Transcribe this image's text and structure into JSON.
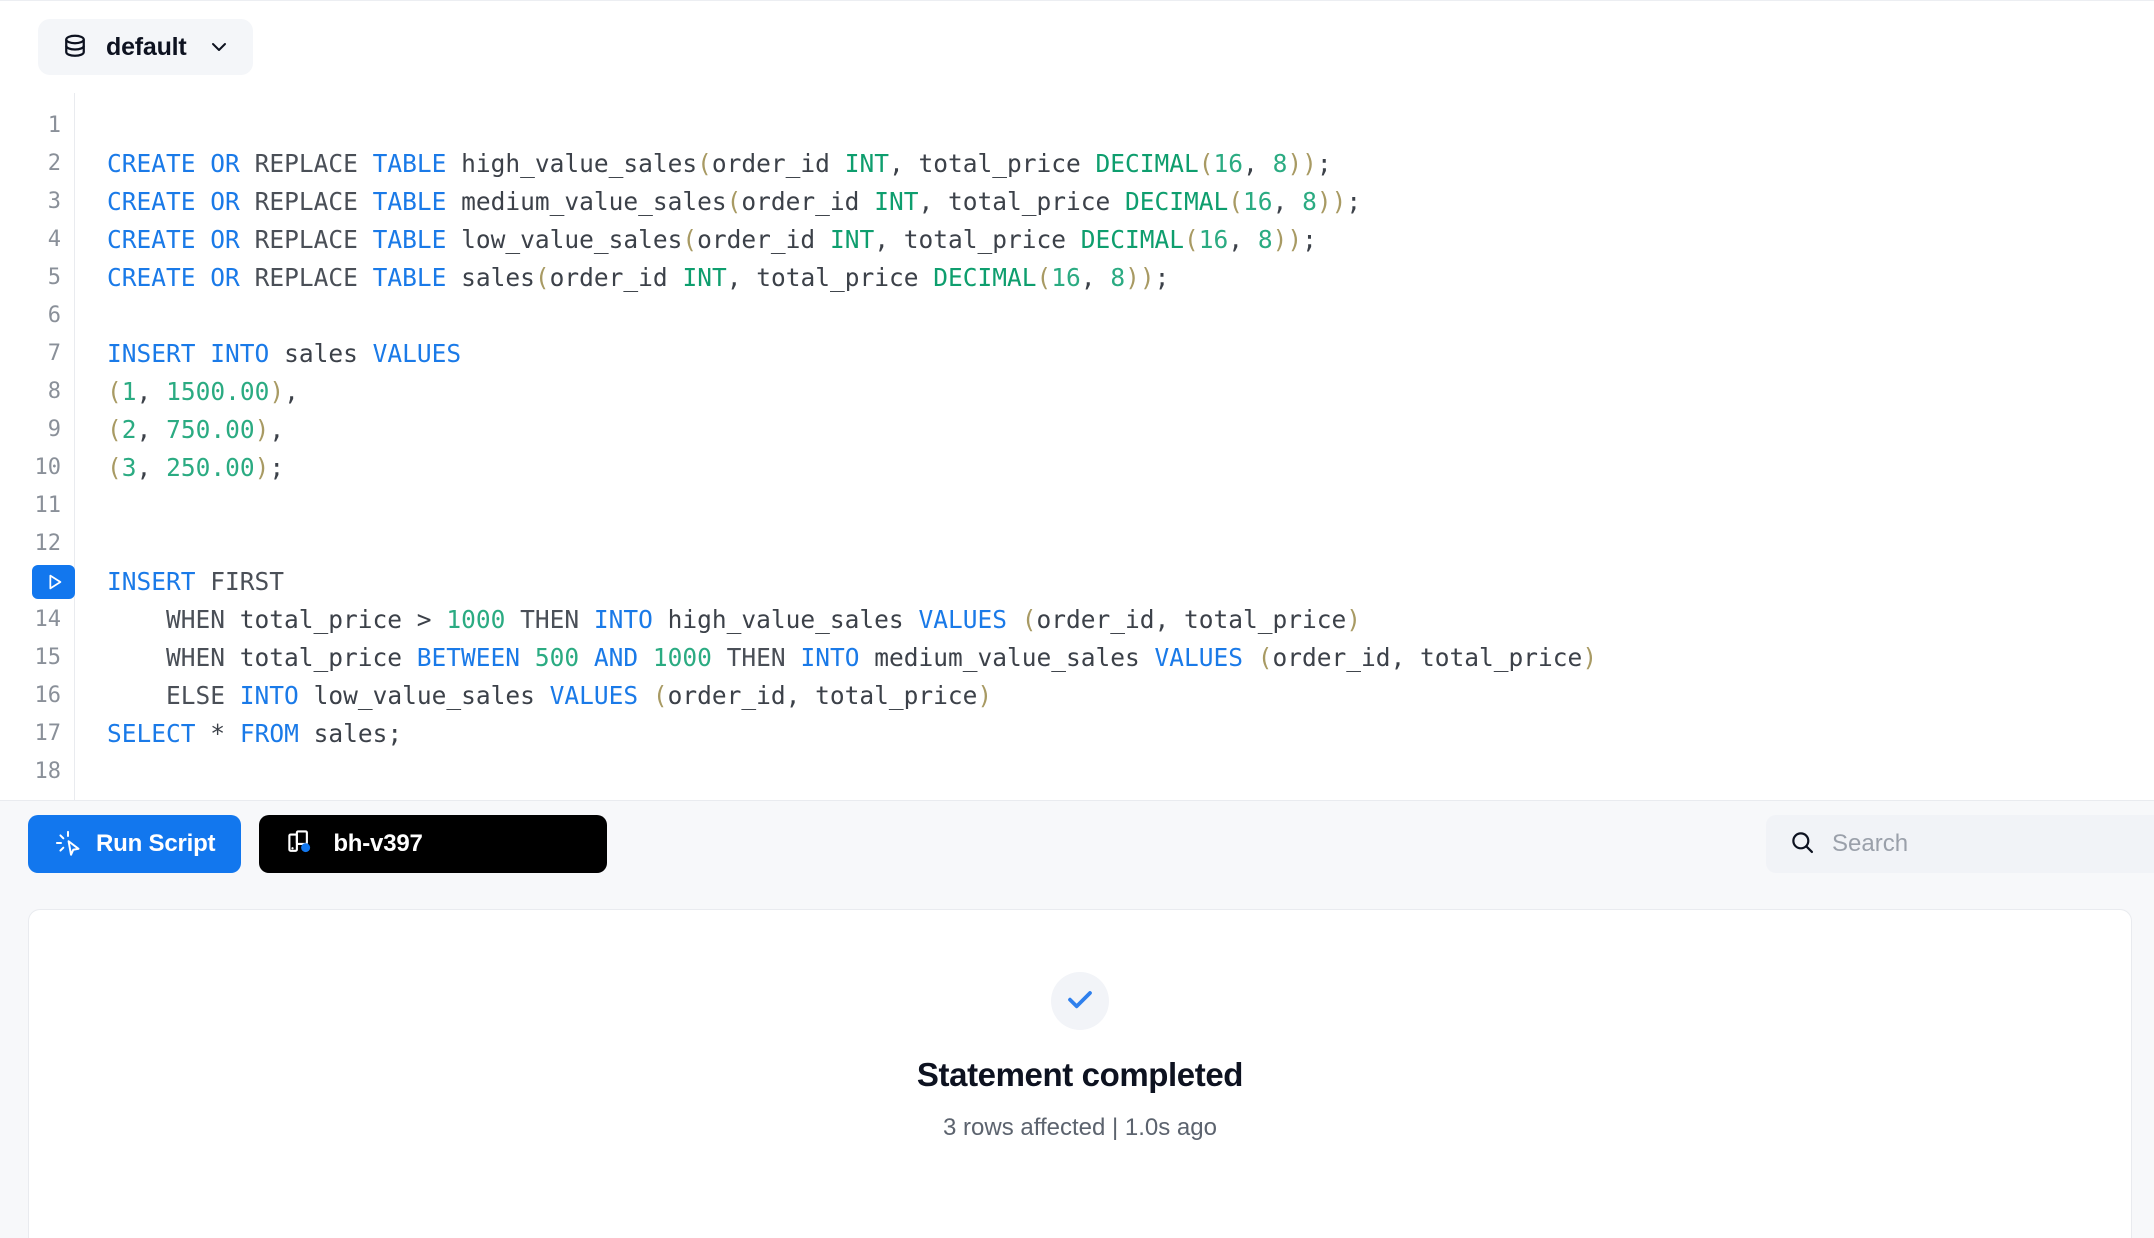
{
  "context_bar": {
    "database_label": "default",
    "database_icon": "database-icon",
    "chevron_icon": "chevron-down-icon"
  },
  "editor": {
    "line_numbers": [
      "1",
      "2",
      "3",
      "4",
      "5",
      "6",
      "7",
      "8",
      "9",
      "10",
      "11",
      "12",
      "13",
      "14",
      "15",
      "16",
      "17",
      "18"
    ],
    "run_line": 13,
    "run_icon": "play-icon",
    "lines": [
      [],
      [
        {
          "t": "CREATE",
          "c": "k"
        },
        {
          "t": " ",
          "c": "op"
        },
        {
          "t": "OR",
          "c": "k"
        },
        {
          "t": " ",
          "c": "op"
        },
        {
          "t": "REPLACE",
          "c": "kd"
        },
        {
          "t": " ",
          "c": "op"
        },
        {
          "t": "TABLE",
          "c": "k"
        },
        {
          "t": " ",
          "c": "op"
        },
        {
          "t": "high_value_sales",
          "c": "id"
        },
        {
          "t": "(",
          "c": "p"
        },
        {
          "t": "order_id",
          "c": "id"
        },
        {
          "t": " ",
          "c": "op"
        },
        {
          "t": "INT",
          "c": "t"
        },
        {
          "t": ",",
          "c": "op"
        },
        {
          "t": " total_price ",
          "c": "id"
        },
        {
          "t": "DECIMAL",
          "c": "t"
        },
        {
          "t": "(",
          "c": "p"
        },
        {
          "t": "16",
          "c": "n"
        },
        {
          "t": ",",
          "c": "op"
        },
        {
          "t": " ",
          "c": "op"
        },
        {
          "t": "8",
          "c": "n"
        },
        {
          "t": "))",
          "c": "p"
        },
        {
          "t": ";",
          "c": "op"
        }
      ],
      [
        {
          "t": "CREATE",
          "c": "k"
        },
        {
          "t": " ",
          "c": "op"
        },
        {
          "t": "OR",
          "c": "k"
        },
        {
          "t": " ",
          "c": "op"
        },
        {
          "t": "REPLACE",
          "c": "kd"
        },
        {
          "t": " ",
          "c": "op"
        },
        {
          "t": "TABLE",
          "c": "k"
        },
        {
          "t": " ",
          "c": "op"
        },
        {
          "t": "medium_value_sales",
          "c": "id"
        },
        {
          "t": "(",
          "c": "p"
        },
        {
          "t": "order_id",
          "c": "id"
        },
        {
          "t": " ",
          "c": "op"
        },
        {
          "t": "INT",
          "c": "t"
        },
        {
          "t": ",",
          "c": "op"
        },
        {
          "t": " total_price ",
          "c": "id"
        },
        {
          "t": "DECIMAL",
          "c": "t"
        },
        {
          "t": "(",
          "c": "p"
        },
        {
          "t": "16",
          "c": "n"
        },
        {
          "t": ",",
          "c": "op"
        },
        {
          "t": " ",
          "c": "op"
        },
        {
          "t": "8",
          "c": "n"
        },
        {
          "t": "))",
          "c": "p"
        },
        {
          "t": ";",
          "c": "op"
        }
      ],
      [
        {
          "t": "CREATE",
          "c": "k"
        },
        {
          "t": " ",
          "c": "op"
        },
        {
          "t": "OR",
          "c": "k"
        },
        {
          "t": " ",
          "c": "op"
        },
        {
          "t": "REPLACE",
          "c": "kd"
        },
        {
          "t": " ",
          "c": "op"
        },
        {
          "t": "TABLE",
          "c": "k"
        },
        {
          "t": " ",
          "c": "op"
        },
        {
          "t": "low_value_sales",
          "c": "id"
        },
        {
          "t": "(",
          "c": "p"
        },
        {
          "t": "order_id",
          "c": "id"
        },
        {
          "t": " ",
          "c": "op"
        },
        {
          "t": "INT",
          "c": "t"
        },
        {
          "t": ",",
          "c": "op"
        },
        {
          "t": " total_price ",
          "c": "id"
        },
        {
          "t": "DECIMAL",
          "c": "t"
        },
        {
          "t": "(",
          "c": "p"
        },
        {
          "t": "16",
          "c": "n"
        },
        {
          "t": ",",
          "c": "op"
        },
        {
          "t": " ",
          "c": "op"
        },
        {
          "t": "8",
          "c": "n"
        },
        {
          "t": "))",
          "c": "p"
        },
        {
          "t": ";",
          "c": "op"
        }
      ],
      [
        {
          "t": "CREATE",
          "c": "k"
        },
        {
          "t": " ",
          "c": "op"
        },
        {
          "t": "OR",
          "c": "k"
        },
        {
          "t": " ",
          "c": "op"
        },
        {
          "t": "REPLACE",
          "c": "kd"
        },
        {
          "t": " ",
          "c": "op"
        },
        {
          "t": "TABLE",
          "c": "k"
        },
        {
          "t": " ",
          "c": "op"
        },
        {
          "t": "sales",
          "c": "id"
        },
        {
          "t": "(",
          "c": "p"
        },
        {
          "t": "order_id",
          "c": "id"
        },
        {
          "t": " ",
          "c": "op"
        },
        {
          "t": "INT",
          "c": "t"
        },
        {
          "t": ",",
          "c": "op"
        },
        {
          "t": " total_price ",
          "c": "id"
        },
        {
          "t": "DECIMAL",
          "c": "t"
        },
        {
          "t": "(",
          "c": "p"
        },
        {
          "t": "16",
          "c": "n"
        },
        {
          "t": ",",
          "c": "op"
        },
        {
          "t": " ",
          "c": "op"
        },
        {
          "t": "8",
          "c": "n"
        },
        {
          "t": "))",
          "c": "p"
        },
        {
          "t": ";",
          "c": "op"
        }
      ],
      [],
      [
        {
          "t": "INSERT",
          "c": "k"
        },
        {
          "t": " ",
          "c": "op"
        },
        {
          "t": "INTO",
          "c": "k"
        },
        {
          "t": " ",
          "c": "op"
        },
        {
          "t": "sales",
          "c": "id"
        },
        {
          "t": " ",
          "c": "op"
        },
        {
          "t": "VALUES",
          "c": "k"
        }
      ],
      [
        {
          "t": "(",
          "c": "p"
        },
        {
          "t": "1",
          "c": "n"
        },
        {
          "t": ",",
          "c": "op"
        },
        {
          "t": " ",
          "c": "op"
        },
        {
          "t": "1500.00",
          "c": "n"
        },
        {
          "t": ")",
          "c": "p"
        },
        {
          "t": ",",
          "c": "op"
        }
      ],
      [
        {
          "t": "(",
          "c": "p"
        },
        {
          "t": "2",
          "c": "n"
        },
        {
          "t": ",",
          "c": "op"
        },
        {
          "t": " ",
          "c": "op"
        },
        {
          "t": "750.00",
          "c": "n"
        },
        {
          "t": ")",
          "c": "p"
        },
        {
          "t": ",",
          "c": "op"
        }
      ],
      [
        {
          "t": "(",
          "c": "p"
        },
        {
          "t": "3",
          "c": "n"
        },
        {
          "t": ",",
          "c": "op"
        },
        {
          "t": " ",
          "c": "op"
        },
        {
          "t": "250.00",
          "c": "n"
        },
        {
          "t": ")",
          "c": "p"
        },
        {
          "t": ";",
          "c": "op"
        }
      ],
      [],
      [],
      [
        {
          "t": "INSERT",
          "c": "k"
        },
        {
          "t": " ",
          "c": "op"
        },
        {
          "t": "FIRST",
          "c": "kd"
        }
      ],
      [
        {
          "t": "    WHEN",
          "c": "kd"
        },
        {
          "t": " total_price ",
          "c": "id"
        },
        {
          "t": ">",
          "c": "op"
        },
        {
          "t": " ",
          "c": "op"
        },
        {
          "t": "1000",
          "c": "n"
        },
        {
          "t": " ",
          "c": "op"
        },
        {
          "t": "THEN",
          "c": "kd"
        },
        {
          "t": " ",
          "c": "op"
        },
        {
          "t": "INTO",
          "c": "k"
        },
        {
          "t": " ",
          "c": "op"
        },
        {
          "t": "high_value_sales",
          "c": "id"
        },
        {
          "t": " ",
          "c": "op"
        },
        {
          "t": "VALUES",
          "c": "k"
        },
        {
          "t": " ",
          "c": "op"
        },
        {
          "t": "(",
          "c": "p"
        },
        {
          "t": "order_id, total_price",
          "c": "id"
        },
        {
          "t": ")",
          "c": "p"
        }
      ],
      [
        {
          "t": "    WHEN",
          "c": "kd"
        },
        {
          "t": " total_price ",
          "c": "id"
        },
        {
          "t": "BETWEEN",
          "c": "k"
        },
        {
          "t": " ",
          "c": "op"
        },
        {
          "t": "500",
          "c": "n"
        },
        {
          "t": " ",
          "c": "op"
        },
        {
          "t": "AND",
          "c": "k"
        },
        {
          "t": " ",
          "c": "op"
        },
        {
          "t": "1000",
          "c": "n"
        },
        {
          "t": " ",
          "c": "op"
        },
        {
          "t": "THEN",
          "c": "kd"
        },
        {
          "t": " ",
          "c": "op"
        },
        {
          "t": "INTO",
          "c": "k"
        },
        {
          "t": " ",
          "c": "op"
        },
        {
          "t": "medium_value_sales",
          "c": "id"
        },
        {
          "t": " ",
          "c": "op"
        },
        {
          "t": "VALUES",
          "c": "k"
        },
        {
          "t": " ",
          "c": "op"
        },
        {
          "t": "(",
          "c": "p"
        },
        {
          "t": "order_id, total_price",
          "c": "id"
        },
        {
          "t": ")",
          "c": "p"
        }
      ],
      [
        {
          "t": "    ELSE",
          "c": "kd"
        },
        {
          "t": " ",
          "c": "op"
        },
        {
          "t": "INTO",
          "c": "k"
        },
        {
          "t": " ",
          "c": "op"
        },
        {
          "t": "low_value_sales",
          "c": "id"
        },
        {
          "t": " ",
          "c": "op"
        },
        {
          "t": "VALUES",
          "c": "k"
        },
        {
          "t": " ",
          "c": "op"
        },
        {
          "t": "(",
          "c": "p"
        },
        {
          "t": "order_id, total_price",
          "c": "id"
        },
        {
          "t": ")",
          "c": "p"
        }
      ],
      [
        {
          "t": "SELECT",
          "c": "k"
        },
        {
          "t": " ",
          "c": "op"
        },
        {
          "t": "*",
          "c": "op"
        },
        {
          "t": " ",
          "c": "op"
        },
        {
          "t": "FROM",
          "c": "k"
        },
        {
          "t": " ",
          "c": "op"
        },
        {
          "t": "sales",
          "c": "id"
        },
        {
          "t": ";",
          "c": "op"
        }
      ],
      []
    ]
  },
  "toolbar": {
    "run_script_label": "Run Script",
    "run_script_icon": "cursor-click-icon",
    "warehouse_label": "bh-v397",
    "warehouse_icon": "warehouse-icon",
    "search_placeholder": "Search",
    "search_value": "",
    "search_icon": "search-icon"
  },
  "results": {
    "status_icon": "check-icon",
    "title": "Statement completed",
    "subtitle": "3 rows affected | 1.0s ago"
  },
  "colors": {
    "accent": "#1277ee",
    "keyword": "#1a7ae8",
    "type": "#0e9e6e",
    "number": "#2bab82",
    "paren": "#a89a63",
    "badge_bg": "#000000"
  }
}
